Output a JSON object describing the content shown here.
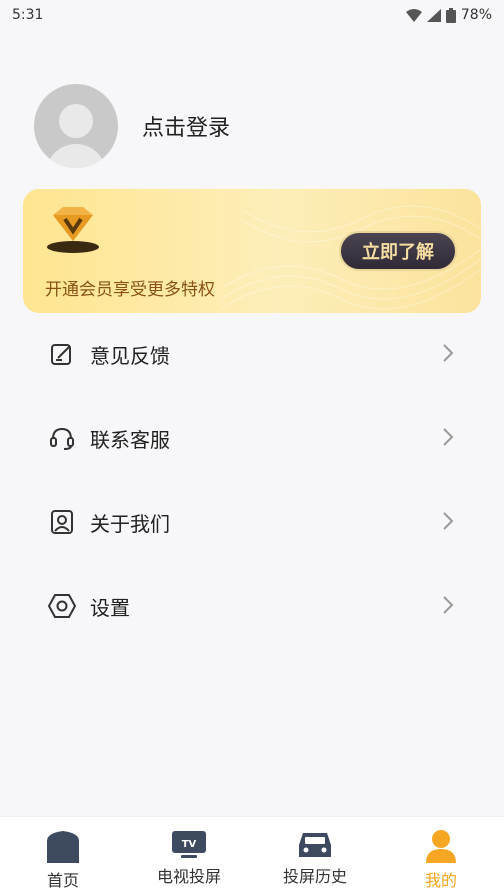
{
  "status_bar": {
    "time": "5:31",
    "battery": "78%"
  },
  "profile": {
    "login_label": "点击登录"
  },
  "vip_card": {
    "description": "开通会员享受更多特权",
    "button_label": "立即了解"
  },
  "menu": [
    {
      "label": "意见反馈",
      "icon": "feedback-edit-icon"
    },
    {
      "label": "联系客服",
      "icon": "headset-icon"
    },
    {
      "label": "关于我们",
      "icon": "about-user-icon"
    },
    {
      "label": "设置",
      "icon": "settings-hexagon-icon"
    }
  ],
  "tabbar": [
    {
      "label": "首页",
      "icon": "home-icon"
    },
    {
      "label": "电视投屏",
      "icon": "tv-icon"
    },
    {
      "label": "投屏历史",
      "icon": "car-icon"
    },
    {
      "label": "我的",
      "icon": "person-icon",
      "active": true
    }
  ],
  "colors": {
    "accent": "#f5a623",
    "vip_gold": "#f5dca1",
    "vip_text": "#8a5316"
  }
}
